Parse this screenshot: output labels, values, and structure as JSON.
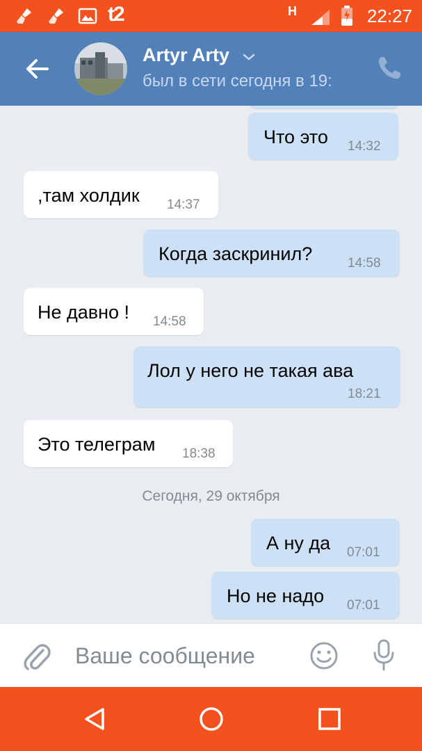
{
  "status_bar": {
    "carrier": "t2",
    "network": "H",
    "time": "22:27",
    "icons": [
      "cleaner-icon",
      "cleaner-icon",
      "image-icon",
      "signal-icon",
      "battery-charging-icon"
    ]
  },
  "header": {
    "contact_name": "Artyr Arty",
    "contact_status": "был в сети сегодня в 19:",
    "icons": [
      "back-arrow-icon",
      "avatar",
      "chevron-down-icon",
      "phone-icon"
    ]
  },
  "messages": [
    {
      "dir": "out",
      "text": "Что это",
      "time": "14:32"
    },
    {
      "dir": "in",
      "text": ",там холдик",
      "time": "14:37"
    },
    {
      "dir": "out",
      "text": "Когда заскринил?",
      "time": "14:58"
    },
    {
      "dir": "in",
      "text": "Не давно !",
      "time": "14:58"
    },
    {
      "dir": "out",
      "text": "Лол у него не такая ава",
      "time": "18:21"
    },
    {
      "dir": "in",
      "text": "Это телеграм",
      "time": "18:38"
    },
    {
      "dir": "out",
      "text": "А ну да",
      "time": "07:01"
    },
    {
      "dir": "out",
      "text": "Но не надо",
      "time": "07:01"
    }
  ],
  "date_separator": "Сегодня, 29 октября",
  "composer": {
    "placeholder": "Ваше сообщение",
    "icons": [
      "attach-icon",
      "emoji-icon",
      "microphone-icon"
    ]
  },
  "nav_bar": {
    "icons": [
      "back-triangle-icon",
      "home-circle-icon",
      "recents-square-icon"
    ]
  },
  "colors": {
    "status_bar": "#f5511e",
    "header": "#5181b8",
    "outgoing_bubble": "#cce0f6",
    "incoming_bubble": "#ffffff",
    "chat_background": "#e9edf1",
    "secondary_text": "#828a92"
  }
}
